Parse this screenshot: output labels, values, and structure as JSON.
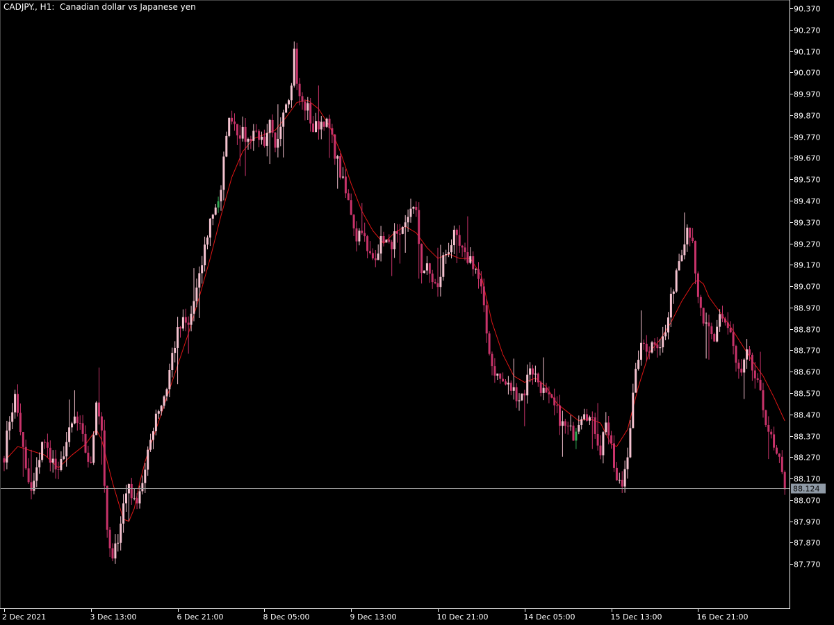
{
  "header": {
    "symbol_timeframe": "CADJPY., H1:",
    "description": "Canadian dollar vs Japanese yen"
  },
  "colors": {
    "background": "#000000",
    "axis_line": "#ffffff",
    "axis_text": "#ffffff",
    "candle_bear": "#c8336a",
    "candle_bull": "#f4c2cf",
    "candle_bull_green": "#33aa55",
    "moving_average": "#e01515",
    "bid_line": "#9a9a9a",
    "price_tag_bg": "#8f9aa6",
    "price_tag_text": "#0a0a0a"
  },
  "chart_data": {
    "type": "candlestick",
    "symbol": "CADJPY.",
    "timeframe": "H1",
    "title": "Canadian dollar vs Japanese yen",
    "current_price": "88.124",
    "y_axis": {
      "min": 87.67,
      "max": 90.37,
      "ticks": [
        "90.370",
        "90.270",
        "90.170",
        "90.070",
        "89.970",
        "89.870",
        "89.770",
        "89.670",
        "89.570",
        "89.470",
        "89.370",
        "89.270",
        "89.170",
        "89.070",
        "88.970",
        "88.870",
        "88.770",
        "88.670",
        "88.570",
        "88.470",
        "88.370",
        "88.270",
        "88.170",
        "88.070",
        "87.970",
        "87.870",
        "87.770"
      ]
    },
    "x_axis": {
      "labels": [
        {
          "label": "2 Dec 2021",
          "bar": 0
        },
        {
          "label": "3 Dec 13:00",
          "bar": 32
        },
        {
          "label": "6 Dec 21:00",
          "bar": 64
        },
        {
          "label": "8 Dec 05:00",
          "bar": 96
        },
        {
          "label": "9 Dec 13:00",
          "bar": 128
        },
        {
          "label": "10 Dec 21:00",
          "bar": 160
        },
        {
          "label": "14 Dec 05:00",
          "bar": 192
        },
        {
          "label": "15 Dec 13:00",
          "bar": 224
        },
        {
          "label": "16 Dec 21:00",
          "bar": 256
        }
      ]
    },
    "close_path": [
      [
        0,
        88.28
      ],
      [
        2,
        88.45
      ],
      [
        4,
        88.55
      ],
      [
        6,
        88.4
      ],
      [
        8,
        88.2
      ],
      [
        10,
        88.1
      ],
      [
        12,
        88.2
      ],
      [
        14,
        88.35
      ],
      [
        16,
        88.3
      ],
      [
        18,
        88.25
      ],
      [
        20,
        88.18
      ],
      [
        22,
        88.3
      ],
      [
        24,
        88.38
      ],
      [
        26,
        88.45
      ],
      [
        28,
        88.4
      ],
      [
        30,
        88.3
      ],
      [
        32,
        88.22
      ],
      [
        34,
        88.55
      ],
      [
        36,
        88.4
      ],
      [
        38,
        87.9
      ],
      [
        40,
        87.78
      ],
      [
        42,
        87.9
      ],
      [
        44,
        88.05
      ],
      [
        46,
        88.15
      ],
      [
        48,
        88.05
      ],
      [
        50,
        88.12
      ],
      [
        52,
        88.2
      ],
      [
        54,
        88.35
      ],
      [
        56,
        88.48
      ],
      [
        58,
        88.52
      ],
      [
        60,
        88.6
      ],
      [
        62,
        88.75
      ],
      [
        64,
        88.85
      ],
      [
        66,
        88.9
      ],
      [
        68,
        88.88
      ],
      [
        70,
        89.0
      ],
      [
        72,
        89.1
      ],
      [
        74,
        89.25
      ],
      [
        76,
        89.38
      ],
      [
        78,
        89.45
      ],
      [
        80,
        89.5
      ],
      [
        82,
        89.8
      ],
      [
        84,
        89.87
      ],
      [
        86,
        89.8
      ],
      [
        88,
        89.78
      ],
      [
        90,
        89.75
      ],
      [
        92,
        89.8
      ],
      [
        94,
        89.78
      ],
      [
        96,
        89.7
      ],
      [
        98,
        89.82
      ],
      [
        100,
        89.7
      ],
      [
        102,
        89.85
      ],
      [
        104,
        89.95
      ],
      [
        106,
        90.0
      ],
      [
        107,
        90.2
      ],
      [
        108,
        90.0
      ],
      [
        110,
        89.92
      ],
      [
        112,
        89.9
      ],
      [
        114,
        89.8
      ],
      [
        116,
        89.83
      ],
      [
        118,
        89.85
      ],
      [
        120,
        89.8
      ],
      [
        122,
        89.7
      ],
      [
        124,
        89.6
      ],
      [
        126,
        89.5
      ],
      [
        128,
        89.42
      ],
      [
        130,
        89.3
      ],
      [
        132,
        89.35
      ],
      [
        134,
        89.22
      ],
      [
        136,
        89.2
      ],
      [
        138,
        89.25
      ],
      [
        140,
        89.3
      ],
      [
        142,
        89.25
      ],
      [
        144,
        89.3
      ],
      [
        146,
        89.28
      ],
      [
        148,
        89.35
      ],
      [
        150,
        89.45
      ],
      [
        152,
        89.4
      ],
      [
        154,
        89.15
      ],
      [
        156,
        89.15
      ],
      [
        158,
        89.1
      ],
      [
        160,
        89.05
      ],
      [
        162,
        89.2
      ],
      [
        164,
        89.25
      ],
      [
        166,
        89.3
      ],
      [
        168,
        89.25
      ],
      [
        170,
        89.2
      ],
      [
        172,
        89.2
      ],
      [
        174,
        89.15
      ],
      [
        176,
        89.05
      ],
      [
        178,
        88.85
      ],
      [
        180,
        88.7
      ],
      [
        182,
        88.65
      ],
      [
        184,
        88.62
      ],
      [
        186,
        88.6
      ],
      [
        188,
        88.58
      ],
      [
        190,
        88.55
      ],
      [
        192,
        88.58
      ],
      [
        194,
        88.7
      ],
      [
        196,
        88.65
      ],
      [
        198,
        88.6
      ],
      [
        200,
        88.55
      ],
      [
        202,
        88.52
      ],
      [
        204,
        88.48
      ],
      [
        206,
        88.42
      ],
      [
        208,
        88.4
      ],
      [
        210,
        88.38
      ],
      [
        212,
        88.45
      ],
      [
        214,
        88.5
      ],
      [
        216,
        88.45
      ],
      [
        218,
        88.4
      ],
      [
        220,
        88.3
      ],
      [
        222,
        88.45
      ],
      [
        224,
        88.3
      ],
      [
        226,
        88.15
      ],
      [
        228,
        88.14
      ],
      [
        230,
        88.3
      ],
      [
        232,
        88.55
      ],
      [
        234,
        88.75
      ],
      [
        236,
        88.8
      ],
      [
        238,
        88.78
      ],
      [
        240,
        88.82
      ],
      [
        242,
        88.8
      ],
      [
        244,
        88.85
      ],
      [
        246,
        89.0
      ],
      [
        248,
        89.15
      ],
      [
        250,
        89.25
      ],
      [
        252,
        89.35
      ],
      [
        254,
        89.3
      ],
      [
        255,
        89.1
      ],
      [
        256,
        89.0
      ],
      [
        258,
        88.9
      ],
      [
        260,
        88.85
      ],
      [
        262,
        88.8
      ],
      [
        264,
        88.95
      ],
      [
        266,
        88.9
      ],
      [
        268,
        88.85
      ],
      [
        270,
        88.7
      ],
      [
        272,
        88.65
      ],
      [
        274,
        88.75
      ],
      [
        276,
        88.68
      ],
      [
        278,
        88.6
      ],
      [
        280,
        88.5
      ],
      [
        282,
        88.4
      ],
      [
        284,
        88.3
      ],
      [
        286,
        88.24
      ],
      [
        288,
        88.12
      ]
    ],
    "ma_path": [
      [
        0,
        88.25
      ],
      [
        5,
        88.32
      ],
      [
        10,
        88.3
      ],
      [
        15,
        88.28
      ],
      [
        20,
        88.22
      ],
      [
        25,
        88.28
      ],
      [
        30,
        88.33
      ],
      [
        34,
        88.4
      ],
      [
        36,
        88.35
      ],
      [
        40,
        88.15
      ],
      [
        44,
        87.98
      ],
      [
        46,
        87.97
      ],
      [
        48,
        88.03
      ],
      [
        50,
        88.15
      ],
      [
        52,
        88.25
      ],
      [
        56,
        88.4
      ],
      [
        60,
        88.55
      ],
      [
        64,
        88.7
      ],
      [
        68,
        88.85
      ],
      [
        72,
        89.02
      ],
      [
        76,
        89.2
      ],
      [
        80,
        89.4
      ],
      [
        84,
        89.58
      ],
      [
        88,
        89.7
      ],
      [
        92,
        89.76
      ],
      [
        96,
        89.78
      ],
      [
        100,
        89.8
      ],
      [
        104,
        89.86
      ],
      [
        108,
        89.93
      ],
      [
        112,
        89.94
      ],
      [
        116,
        89.9
      ],
      [
        120,
        89.82
      ],
      [
        124,
        89.7
      ],
      [
        128,
        89.55
      ],
      [
        132,
        89.42
      ],
      [
        136,
        89.33
      ],
      [
        140,
        89.27
      ],
      [
        144,
        89.32
      ],
      [
        148,
        89.35
      ],
      [
        152,
        89.32
      ],
      [
        156,
        89.25
      ],
      [
        160,
        89.2
      ],
      [
        164,
        89.22
      ],
      [
        168,
        89.2
      ],
      [
        172,
        89.2
      ],
      [
        176,
        89.12
      ],
      [
        180,
        88.9
      ],
      [
        184,
        88.75
      ],
      [
        188,
        88.65
      ],
      [
        192,
        88.62
      ],
      [
        196,
        88.64
      ],
      [
        200,
        88.6
      ],
      [
        204,
        88.52
      ],
      [
        208,
        88.48
      ],
      [
        212,
        88.44
      ],
      [
        216,
        88.45
      ],
      [
        220,
        88.43
      ],
      [
        224,
        88.33
      ],
      [
        226,
        88.32
      ],
      [
        230,
        88.4
      ],
      [
        234,
        88.6
      ],
      [
        238,
        88.76
      ],
      [
        242,
        88.82
      ],
      [
        246,
        88.9
      ],
      [
        250,
        89.0
      ],
      [
        254,
        89.08
      ],
      [
        256,
        89.1
      ],
      [
        258,
        89.08
      ],
      [
        260,
        89.02
      ],
      [
        264,
        88.95
      ],
      [
        268,
        88.88
      ],
      [
        272,
        88.8
      ],
      [
        276,
        88.72
      ],
      [
        280,
        88.65
      ],
      [
        284,
        88.55
      ],
      [
        288,
        88.44
      ]
    ]
  }
}
